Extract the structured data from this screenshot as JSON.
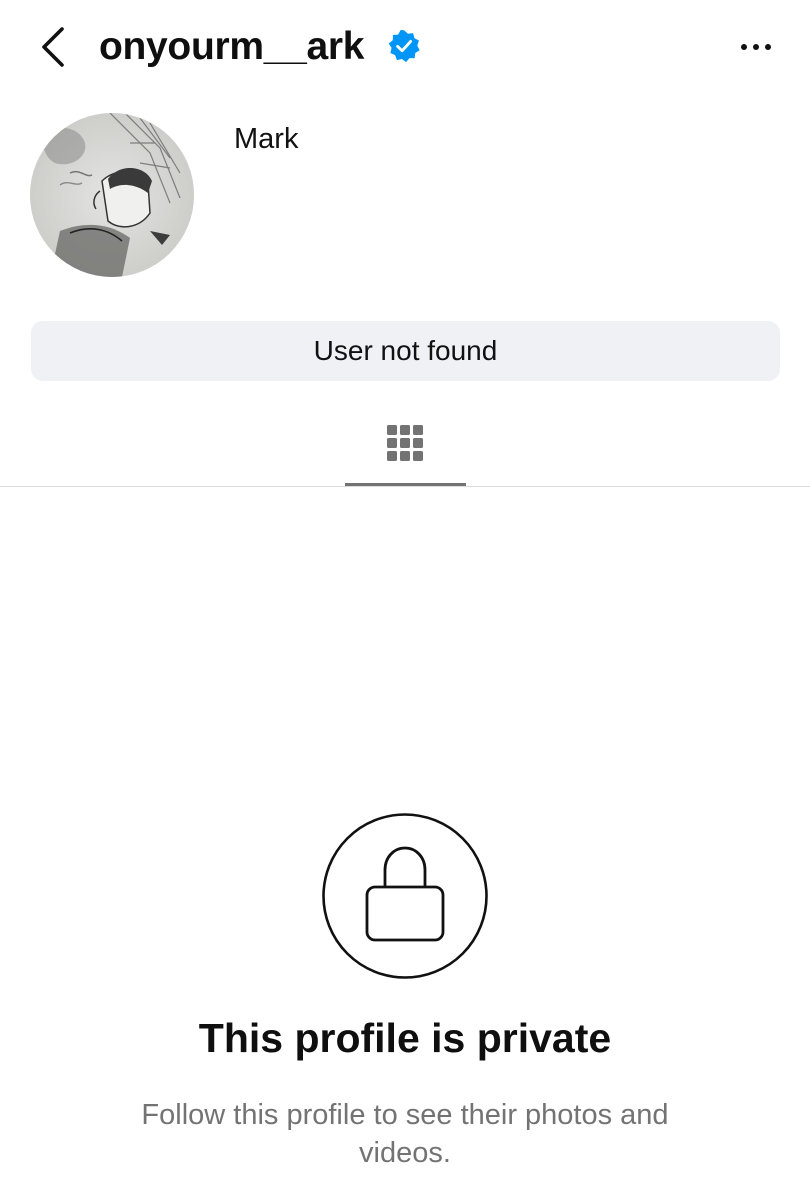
{
  "header": {
    "username": "onyourm__ark",
    "verified": true,
    "back_icon": "chevron-left-icon",
    "more_icon": "more-horizontal-icon"
  },
  "profile": {
    "display_name": "Mark",
    "avatar": "sketch-drawing-avatar"
  },
  "status_button": {
    "label": "User not found"
  },
  "tabs": [
    {
      "icon": "grid-icon",
      "active": true
    }
  ],
  "private_notice": {
    "icon": "lock-icon",
    "title": "This profile is private",
    "subtitle": "Follow this profile to see their photos and videos."
  },
  "colors": {
    "verified_badge": "#0095f6",
    "status_button_bg": "#eff1f4",
    "secondary_text": "#737373"
  }
}
